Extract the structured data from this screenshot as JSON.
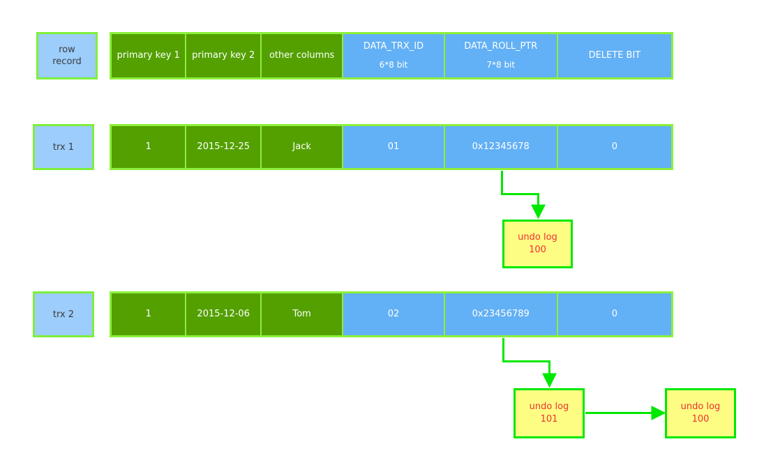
{
  "diagram": {
    "title": "MySQL InnoDB row record with DATA_TRX_ID / DATA_ROLL_PTR and undo log chain",
    "colors": {
      "label_fill": "#9ccdfb",
      "label_border": "#7ef03a",
      "green_cell": "#53a000",
      "blue_cell": "#62b0f5",
      "row_border": "#8bf03a",
      "undo_fill": "#fdfd84",
      "undo_border": "#00e800",
      "undo_text": "#f03030",
      "arrow": "#00e800"
    }
  },
  "labels": {
    "row_record": "row\nrecord",
    "trx1": "trx 1",
    "trx2": "trx 2"
  },
  "columns": {
    "primary_key_1": "primary key 1",
    "primary_key_2": "primary key 2",
    "other_columns": "other columns",
    "data_trx_id": "DATA_TRX_ID",
    "data_trx_id_sub": "6*8 bit",
    "data_roll_ptr": "DATA_ROLL_PTR",
    "data_roll_ptr_sub": "7*8 bit",
    "delete_bit": "DELETE BIT"
  },
  "rows": {
    "trx1": {
      "primary_key_1": "1",
      "primary_key_2": "2015-12-25",
      "other_columns": "Jack",
      "data_trx_id": "01",
      "data_roll_ptr": "0x12345678",
      "delete_bit": "0"
    },
    "trx2": {
      "primary_key_1": "1",
      "primary_key_2": "2015-12-06",
      "other_columns": "Tom",
      "data_trx_id": "02",
      "data_roll_ptr": "0x23456789",
      "delete_bit": "0"
    }
  },
  "undo_logs": {
    "top_100": "undo log\n100",
    "bottom_101": "undo log\n101",
    "bottom_100": "undo log\n100"
  }
}
